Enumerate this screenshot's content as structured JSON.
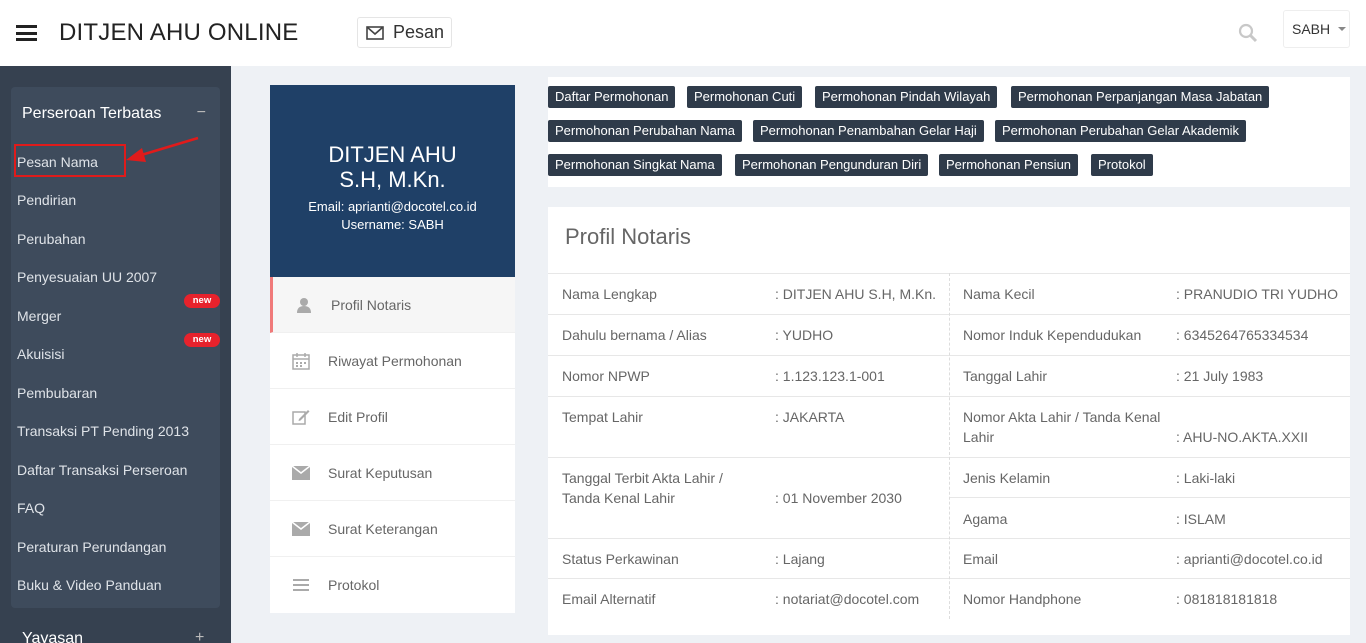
{
  "header": {
    "brand": "DITJEN AHU ONLINE",
    "pesan_label": "Pesan",
    "user_label": "SABH"
  },
  "sidebar": {
    "section_title": "Perseroan Terbatas",
    "collapse_symbol": "−",
    "items": [
      {
        "label": "Pesan Nama"
      },
      {
        "label": "Pendirian"
      },
      {
        "label": "Perubahan"
      },
      {
        "label": "Penyesuaian UU 2007"
      },
      {
        "label": "Merger",
        "badge": "new"
      },
      {
        "label": "Akuisisi",
        "badge": "new"
      },
      {
        "label": "Pembubaran"
      },
      {
        "label": "Transaksi PT Pending 2013"
      },
      {
        "label": "Daftar Transaksi Perseroan"
      },
      {
        "label": "FAQ"
      },
      {
        "label": "Peraturan Perundangan"
      },
      {
        "label": "Buku & Video Panduan"
      }
    ],
    "next_section": "Yayasan",
    "expand_symbol": "+"
  },
  "profile": {
    "name_line1": "DITJEN AHU",
    "name_line2": "S.H, M.Kn.",
    "email": "Email: aprianti@docotel.co.id",
    "username": "Username: SABH"
  },
  "profile_menu": [
    {
      "label": "Profil Notaris",
      "icon": "user-icon"
    },
    {
      "label": "Riwayat Permohonan",
      "icon": "calendar-icon"
    },
    {
      "label": "Edit Profil",
      "icon": "edit-icon"
    },
    {
      "label": "Surat Keputusan",
      "icon": "envelope-icon"
    },
    {
      "label": "Surat Keterangan",
      "icon": "envelope-icon"
    },
    {
      "label": "Protokol",
      "icon": "list-icon"
    }
  ],
  "tags": [
    "Daftar Permohonan",
    "Permohonan Cuti",
    "Permohonan Pindah Wilayah",
    "Permohonan Perpanjangan Masa Jabatan",
    "Permohonan Perubahan Nama",
    "Permohonan Penambahan Gelar Haji",
    "Permohonan Perubahan Gelar Akademik",
    "Permohonan Singkat Nama",
    "Permohonan Pengunduran Diri",
    "Permohonan Pensiun",
    "Protokol"
  ],
  "profil": {
    "title": "Profil Notaris",
    "left": [
      {
        "label": "Nama Lengkap",
        "value": ": DITJEN AHU S.H, M.Kn."
      },
      {
        "label": "Dahulu bernama / Alias",
        "value": ": YUDHO"
      },
      {
        "label": "Nomor NPWP",
        "value": ": 1.123.123.1-001"
      },
      {
        "label": "Tempat Lahir",
        "value": ": JAKARTA"
      },
      {
        "label": "Tanggal Terbit Akta Lahir / Tanda Kenal Lahir",
        "value": ": 01 November 2030"
      },
      {
        "label": "Status Perkawinan",
        "value": ": Lajang"
      },
      {
        "label": "Email Alternatif",
        "value": ": notariat@docotel.com"
      }
    ],
    "right": [
      {
        "label": "Nama Kecil",
        "value": ": PRANUDIO TRI YUDHO"
      },
      {
        "label": "Nomor Induk Kependudukan",
        "value": ": 6345264765334534"
      },
      {
        "label": "Tanggal Lahir",
        "value": ": 21 July 1983"
      },
      {
        "label": "Nomor Akta Lahir / Tanda Kenal Lahir",
        "value": ": AHU-NO.AKTA.XXII"
      },
      {
        "label": "Jenis Kelamin",
        "value": ": Laki-laki"
      },
      {
        "label": "Agama",
        "value": ": ISLAM"
      },
      {
        "label": "Email",
        "value": ": aprianti@docotel.co.id"
      },
      {
        "label": "Nomor Handphone",
        "value": ": 081818181818"
      }
    ]
  }
}
